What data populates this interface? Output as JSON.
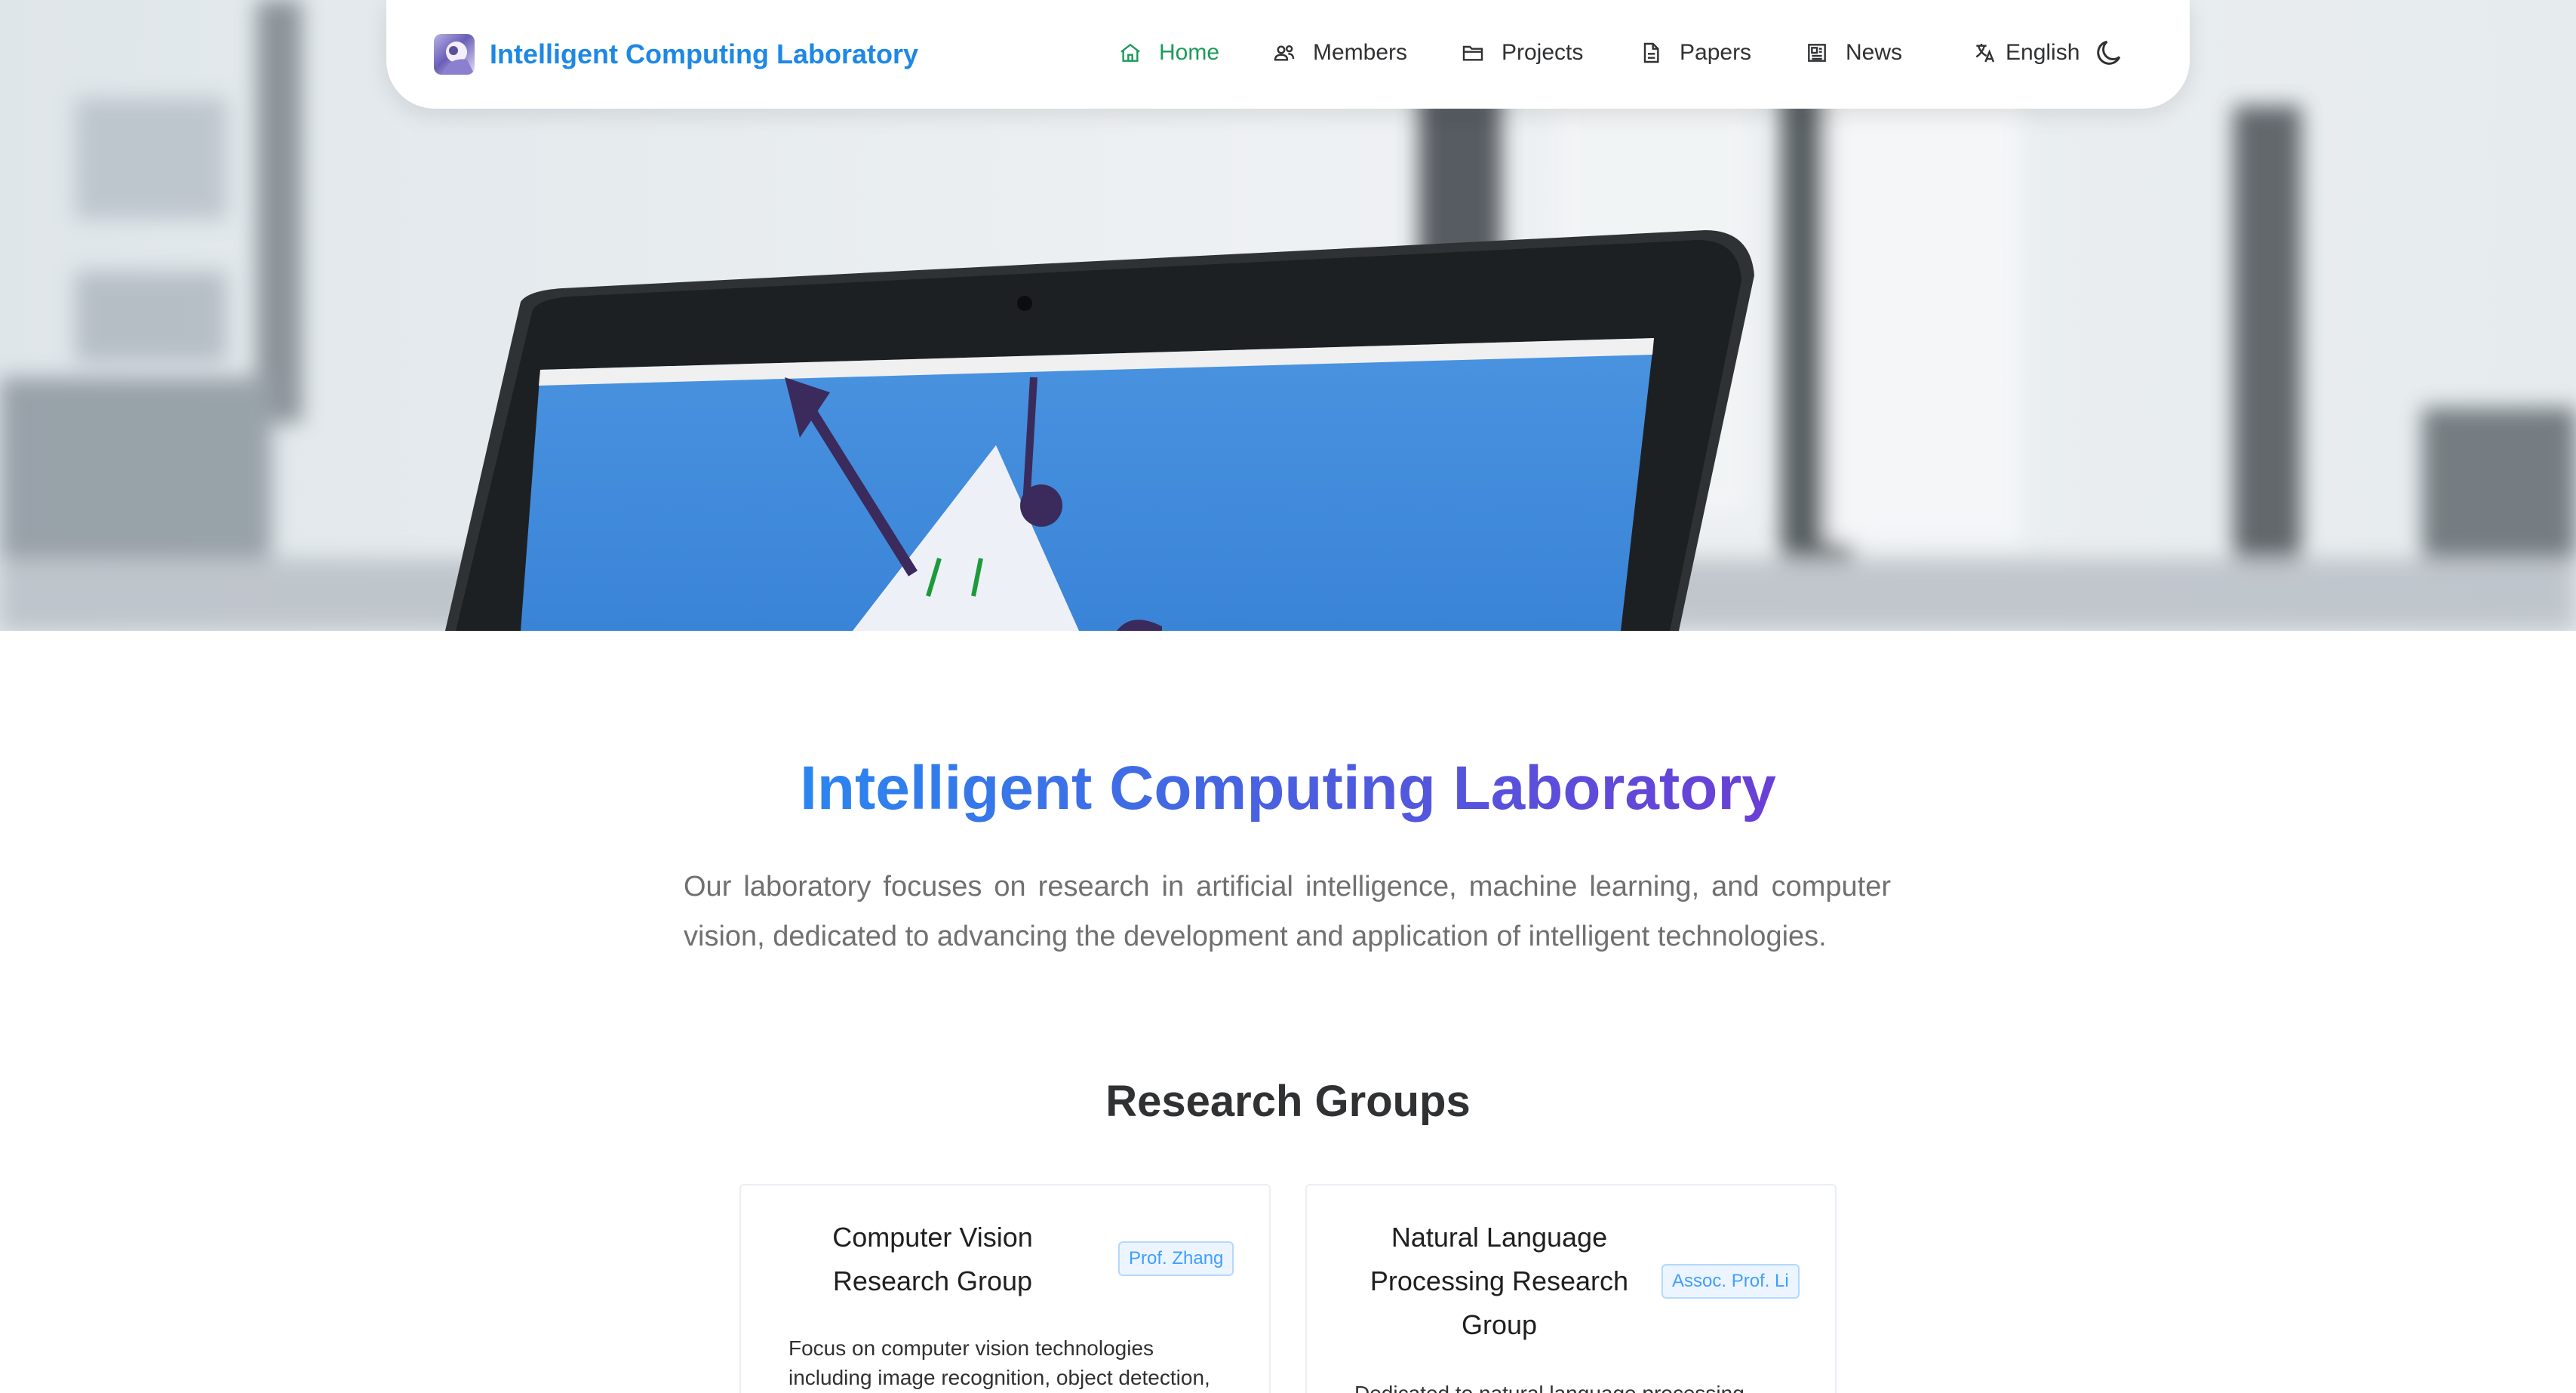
{
  "navbar": {
    "brand_title": "Intelligent Computing Laboratory",
    "menu": [
      {
        "label": "Home",
        "icon": "home-icon",
        "active": true
      },
      {
        "label": "Members",
        "icon": "members-icon",
        "active": false
      },
      {
        "label": "Projects",
        "icon": "folder-icon",
        "active": false
      },
      {
        "label": "Papers",
        "icon": "document-icon",
        "active": false
      },
      {
        "label": "News",
        "icon": "newspaper-icon",
        "active": false
      }
    ],
    "language": "English",
    "theme_icon": "moon-icon"
  },
  "main": {
    "title": "Intelligent Computing Laboratory",
    "description": "Our laboratory focuses on research in artificial intelligence, machine learning, and computer vision, dedicated to advancing the development and application of intelligent technologies.",
    "groups_title": "Research Groups",
    "groups": [
      {
        "name": "Computer Vision Research Group",
        "leader": "Prof. Zhang",
        "description": "Focus on computer vision technologies including image recognition, object detection,"
      },
      {
        "name": "Natural Language Processing Research Group",
        "leader": "Assoc. Prof. Li",
        "description": "Dedicated to natural language processing"
      }
    ]
  },
  "colors": {
    "brand": "#1e88e5",
    "active_nav": "#1b9a59",
    "title_gradient_start": "#2a86f0",
    "title_gradient_end": "#6a3fd6",
    "tag_bg": "#ecf5ff",
    "tag_text": "#409eff"
  }
}
